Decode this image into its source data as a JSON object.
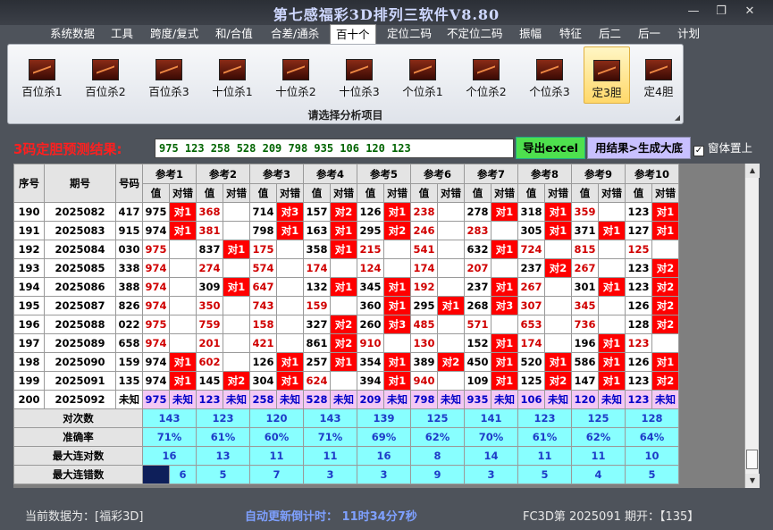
{
  "window": {
    "title": "第七感福彩3D排列三软件V8.80",
    "min": "—",
    "max": "❐",
    "close": "✕"
  },
  "menu": [
    "系统数据",
    "工具",
    "跨度/复式",
    "和/合值",
    "合差/通杀",
    "百十个",
    "定位二码",
    "不定位二码",
    "振幅",
    "特征",
    "后二",
    "后一",
    "计划"
  ],
  "active_menu": "百十个",
  "ribbon": {
    "buttons": [
      "百位杀1",
      "百位杀2",
      "百位杀3",
      "十位杀1",
      "十位杀2",
      "十位杀3",
      "个位杀1",
      "个位杀2",
      "个位杀3",
      "定3胆",
      "定4胆"
    ],
    "selected": "定3胆",
    "caption": "请选择分析项目"
  },
  "prediction": {
    "label": "3码定胆预测结果:",
    "value": "975 123 258 528 209 798 935 106 120 123"
  },
  "buttons": {
    "export": "导出excel",
    "generate": "用结果>生成大底",
    "ontop": "窗体置上",
    "ontop_checked": "✓"
  },
  "table": {
    "headers": {
      "seq": "序号",
      "period": "期号",
      "code": "号码",
      "refs": [
        "参考1",
        "参考2",
        "参考3",
        "参考4",
        "参考5",
        "参考6",
        "参考7",
        "参考8",
        "参考9",
        "参考10"
      ],
      "val": "值",
      "hit": "对错"
    },
    "rows": [
      {
        "seq": "190",
        "period": "2025082",
        "code": "417",
        "cells": [
          [
            "975",
            "对1"
          ],
          [
            "368",
            ""
          ],
          [
            "714",
            "对3"
          ],
          [
            "157",
            "对2"
          ],
          [
            "126",
            "对1"
          ],
          [
            "238",
            ""
          ],
          [
            "278",
            "对1"
          ],
          [
            "318",
            "对1"
          ],
          [
            "359",
            ""
          ],
          [
            "123",
            "对1"
          ]
        ]
      },
      {
        "seq": "191",
        "period": "2025083",
        "code": "915",
        "cells": [
          [
            "974",
            "对1"
          ],
          [
            "381",
            ""
          ],
          [
            "798",
            "对1"
          ],
          [
            "163",
            "对1"
          ],
          [
            "295",
            "对2"
          ],
          [
            "246",
            ""
          ],
          [
            "283",
            ""
          ],
          [
            "305",
            "对1"
          ],
          [
            "371",
            "对1"
          ],
          [
            "127",
            "对1"
          ]
        ]
      },
      {
        "seq": "192",
        "period": "2025084",
        "code": "030",
        "cells": [
          [
            "975",
            ""
          ],
          [
            "837",
            "对1"
          ],
          [
            "175",
            ""
          ],
          [
            "358",
            "对1"
          ],
          [
            "215",
            ""
          ],
          [
            "541",
            ""
          ],
          [
            "632",
            "对1"
          ],
          [
            "724",
            ""
          ],
          [
            "815",
            ""
          ],
          [
            "125",
            ""
          ]
        ]
      },
      {
        "seq": "193",
        "period": "2025085",
        "code": "338",
        "cells": [
          [
            "974",
            ""
          ],
          [
            "274",
            ""
          ],
          [
            "574",
            ""
          ],
          [
            "174",
            ""
          ],
          [
            "124",
            ""
          ],
          [
            "174",
            ""
          ],
          [
            "207",
            ""
          ],
          [
            "237",
            "对2"
          ],
          [
            "267",
            ""
          ],
          [
            "123",
            "对2"
          ]
        ]
      },
      {
        "seq": "194",
        "period": "2025086",
        "code": "388",
        "cells": [
          [
            "974",
            ""
          ],
          [
            "309",
            "对1"
          ],
          [
            "647",
            ""
          ],
          [
            "132",
            "对1"
          ],
          [
            "345",
            "对1"
          ],
          [
            "192",
            ""
          ],
          [
            "237",
            "对1"
          ],
          [
            "267",
            ""
          ],
          [
            "301",
            "对1"
          ],
          [
            "123",
            "对2"
          ]
        ]
      },
      {
        "seq": "195",
        "period": "2025087",
        "code": "826",
        "cells": [
          [
            "974",
            ""
          ],
          [
            "350",
            ""
          ],
          [
            "743",
            ""
          ],
          [
            "159",
            ""
          ],
          [
            "360",
            "对1"
          ],
          [
            "295",
            "对1"
          ],
          [
            "268",
            "对3"
          ],
          [
            "307",
            ""
          ],
          [
            "345",
            ""
          ],
          [
            "126",
            "对2"
          ]
        ]
      },
      {
        "seq": "196",
        "period": "2025088",
        "code": "022",
        "cells": [
          [
            "975",
            ""
          ],
          [
            "759",
            ""
          ],
          [
            "158",
            ""
          ],
          [
            "327",
            "对2"
          ],
          [
            "260",
            "对3"
          ],
          [
            "485",
            ""
          ],
          [
            "571",
            ""
          ],
          [
            "653",
            ""
          ],
          [
            "736",
            ""
          ],
          [
            "128",
            "对2"
          ]
        ]
      },
      {
        "seq": "197",
        "period": "2025089",
        "code": "658",
        "cells": [
          [
            "974",
            ""
          ],
          [
            "201",
            ""
          ],
          [
            "421",
            ""
          ],
          [
            "861",
            "对2"
          ],
          [
            "910",
            ""
          ],
          [
            "130",
            ""
          ],
          [
            "152",
            "对1"
          ],
          [
            "174",
            ""
          ],
          [
            "196",
            "对1"
          ],
          [
            "123",
            ""
          ]
        ]
      },
      {
        "seq": "198",
        "period": "2025090",
        "code": "159",
        "cells": [
          [
            "974",
            "对1"
          ],
          [
            "602",
            ""
          ],
          [
            "126",
            "对1"
          ],
          [
            "257",
            "对1"
          ],
          [
            "354",
            "对1"
          ],
          [
            "389",
            "对2"
          ],
          [
            "450",
            "对1"
          ],
          [
            "520",
            "对1"
          ],
          [
            "586",
            "对1"
          ],
          [
            "126",
            "对1"
          ]
        ]
      },
      {
        "seq": "199",
        "period": "2025091",
        "code": "135",
        "cells": [
          [
            "974",
            "对1"
          ],
          [
            "145",
            "对2"
          ],
          [
            "304",
            "对1"
          ],
          [
            "624",
            ""
          ],
          [
            "394",
            "对1"
          ],
          [
            "940",
            ""
          ],
          [
            "109",
            "对1"
          ],
          [
            "125",
            "对2"
          ],
          [
            "147",
            "对1"
          ],
          [
            "123",
            "对2"
          ]
        ]
      },
      {
        "seq": "200",
        "period": "2025092",
        "code": "未知",
        "cells": [
          [
            "975",
            "未知"
          ],
          [
            "123",
            "未知"
          ],
          [
            "258",
            "未知"
          ],
          [
            "528",
            "未知"
          ],
          [
            "209",
            "未知"
          ],
          [
            "798",
            "未知"
          ],
          [
            "935",
            "未知"
          ],
          [
            "106",
            "未知"
          ],
          [
            "120",
            "未知"
          ],
          [
            "123",
            "未知"
          ]
        ]
      }
    ],
    "stats": [
      {
        "label": "对次数",
        "values": [
          "143",
          "123",
          "120",
          "143",
          "139",
          "125",
          "141",
          "123",
          "125",
          "128"
        ]
      },
      {
        "label": "准确率",
        "values": [
          "71%",
          "61%",
          "60%",
          "71%",
          "69%",
          "62%",
          "70%",
          "61%",
          "62%",
          "64%"
        ]
      },
      {
        "label": "最大连对数",
        "values": [
          "16",
          "13",
          "11",
          "11",
          "16",
          "8",
          "14",
          "11",
          "11",
          "10"
        ]
      },
      {
        "label": "最大连错数",
        "values": [
          "6",
          "5",
          "7",
          "3",
          "3",
          "9",
          "3",
          "5",
          "4",
          "5"
        ]
      }
    ]
  },
  "status": {
    "current": "当前数据为：[福彩3D]",
    "countdown": "自动更新倒计时：   11时34分7秒",
    "period": "FC3D第 2025091 期开：【135】"
  },
  "colors": {
    "hit": "#ff0000",
    "unknown_row": "#f4c8f4",
    "stats": "#88ffff"
  }
}
